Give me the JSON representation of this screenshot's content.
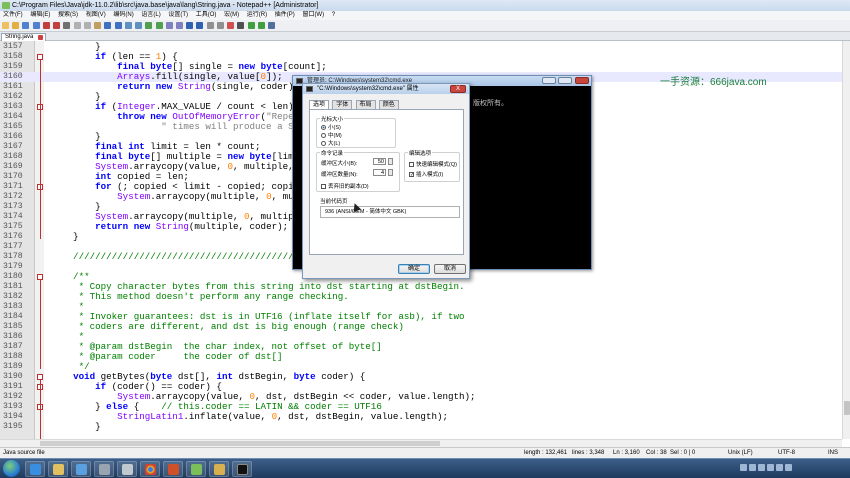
{
  "window": {
    "title": "C:\\Program Files\\Java\\jdk-11.0.2\\lib\\src\\java.base\\java\\lang\\String.java - Notepad++ [Administrator]"
  },
  "menu": [
    "文件(F)",
    "编辑(E)",
    "搜索(S)",
    "视图(V)",
    "编码(N)",
    "语言(L)",
    "设置(T)",
    "工具(O)",
    "宏(M)",
    "运行(R)",
    "插件(P)",
    "窗口(W)",
    "?"
  ],
  "tab": {
    "label": "String.java"
  },
  "editor": {
    "lines": [
      {
        "n": "3157",
        "code": "        }"
      },
      {
        "n": "3158",
        "code": "        if (len == 1) {"
      },
      {
        "n": "3159",
        "code": "            final byte[] single = new byte[count];"
      },
      {
        "n": "3160",
        "code": "            Arrays.fill(single, value[0]);"
      },
      {
        "n": "3161",
        "code": "            return new String(single, coder);"
      },
      {
        "n": "3162",
        "code": "        }"
      },
      {
        "n": "3163",
        "code": "        if (Integer.MAX_VALUE / count < len) {"
      },
      {
        "n": "3164",
        "code": "            throw new OutOfMemoryError(\"Repeating \" + len + \" bytes String \" + count +"
      },
      {
        "n": "3165",
        "code": "                    \" times will produce a String exceeding maximum size.\");"
      },
      {
        "n": "3166",
        "code": "        }"
      },
      {
        "n": "3167",
        "code": "        final int limit = len * count;"
      },
      {
        "n": "3168",
        "code": "        final byte[] multiple = new byte[limit];"
      },
      {
        "n": "3169",
        "code": "        System.arraycopy(value, 0, multiple, 0, len);"
      },
      {
        "n": "3170",
        "code": "        int copied = len;"
      },
      {
        "n": "3171",
        "code": "        for (; copied < limit - copied; copied <<= 1) {"
      },
      {
        "n": "3172",
        "code": "            System.arraycopy(multiple, 0, multiple, copied, copied);"
      },
      {
        "n": "3173",
        "code": "        }"
      },
      {
        "n": "3174",
        "code": "        System.arraycopy(multiple, 0, multiple, copied, limit - copied);"
      },
      {
        "n": "3175",
        "code": "        return new String(multiple, coder);"
      },
      {
        "n": "3176",
        "code": "    }"
      },
      {
        "n": "3177",
        "code": ""
      },
      {
        "n": "3178",
        "code": "    ////////////////////////////////////////////////////////////////"
      },
      {
        "n": "3179",
        "code": ""
      },
      {
        "n": "3180",
        "code": "    /**"
      },
      {
        "n": "3181",
        "code": "     * Copy character bytes from this string into dst starting at dstBegin."
      },
      {
        "n": "3182",
        "code": "     * This method doesn't perform any range checking."
      },
      {
        "n": "3183",
        "code": "     *"
      },
      {
        "n": "3184",
        "code": "     * Invoker guarantees: dst is in UTF16 (inflate itself for asb), if two"
      },
      {
        "n": "3185",
        "code": "     * coders are different, and dst is big enough (range check)"
      },
      {
        "n": "3186",
        "code": "     *"
      },
      {
        "n": "3187",
        "code": "     * @param dstBegin  the char index, not offset of byte[]"
      },
      {
        "n": "3188",
        "code": "     * @param coder     the coder of dst[]"
      },
      {
        "n": "3189",
        "code": "     */"
      },
      {
        "n": "3190",
        "code": "    void getBytes(byte dst[], int dstBegin, byte coder) {"
      },
      {
        "n": "3191",
        "code": "        if (coder() == coder) {"
      },
      {
        "n": "3192",
        "code": "            System.arraycopy(value, 0, dst, dstBegin << coder, value.length);"
      },
      {
        "n": "3193",
        "code": "        } else {    // this.coder == LATIN && coder == UTF16"
      },
      {
        "n": "3194",
        "code": "            StringLatin1.inflate(value, 0, dst, dstBegin, value.length);"
      },
      {
        "n": "3195",
        "code": "        }"
      }
    ]
  },
  "status": {
    "filetype": "Java source file",
    "length": "length : 132,461",
    "lines": "lines : 3,348",
    "ln": "Ln : 3,160",
    "col": "Col : 38",
    "sel": "Sel : 0 | 0",
    "eol": "Unix (LF)",
    "encoding": "UTF-8",
    "mode": "INS"
  },
  "console": {
    "title": "管理员: C:\\Windows\\system32\\cmd.exe",
    "text": "版权所有。"
  },
  "dialog": {
    "title": "\"C:\\Windows\\system32\\cmd.exe\" 属性",
    "close_label": "X",
    "tabs": [
      "选项",
      "字体",
      "布局",
      "颜色"
    ],
    "cursor_size": {
      "label": "光标大小",
      "options": [
        "小(S)",
        "中(M)",
        "大(L)"
      ],
      "selected": 0
    },
    "history": {
      "label": "命令记录",
      "buffer_label": "缓冲区大小(B):",
      "buffer_value": "50",
      "count_label": "缓冲区数量(N):",
      "count_value": "4",
      "discard_label": "丢弃旧的副本(D)"
    },
    "edit_options": {
      "label": "编辑选项",
      "quick_edit": "快速编辑模式(Q)",
      "insert": "插入模式(I)"
    },
    "codepage": {
      "label": "当前代码页",
      "value": "936   (ANSI/OEM - 简体中文 GBK)"
    },
    "ok_label": "确定",
    "cancel_label": "取消"
  },
  "watermark": "一手资源：666java.com",
  "clock": {
    "time": "",
    "date": ""
  }
}
